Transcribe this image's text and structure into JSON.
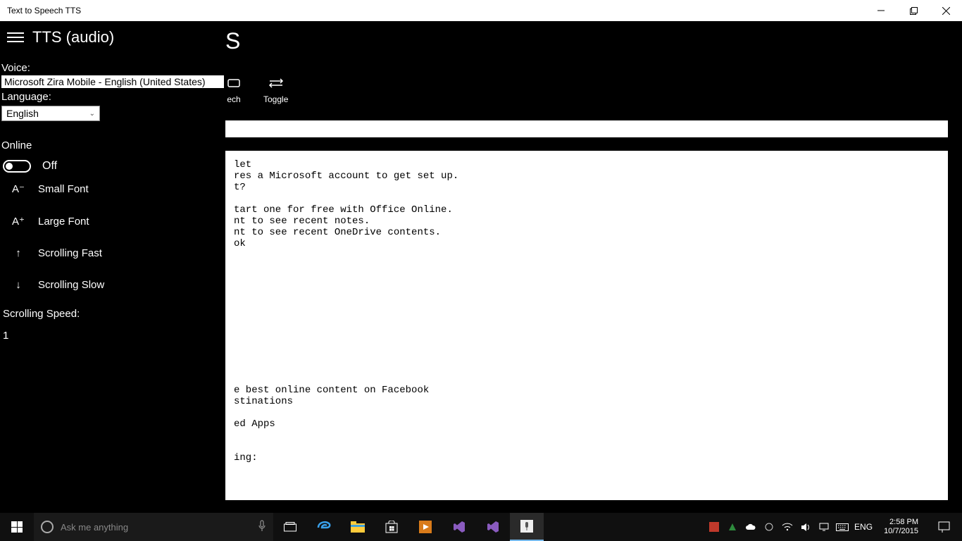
{
  "window": {
    "title": "Text to Speech TTS"
  },
  "main": {
    "title_suffix": "S",
    "toolbar": {
      "speech_label": "ech",
      "toggle_label": "Toggle"
    },
    "content_lines": [
      "let",
      "res a Microsoft account to get set up.",
      "t?",
      "",
      "tart one for free with Office Online.",
      "nt to see recent notes.",
      "nt to see recent OneDrive contents.",
      "ok",
      "",
      "",
      "",
      "",
      "",
      "",
      "",
      "",
      "",
      "",
      "",
      "",
      "e best online content on Facebook",
      "stinations",
      "",
      "ed Apps",
      "",
      "",
      "ing:"
    ]
  },
  "sidebar": {
    "title": "TTS (audio)",
    "voice_label": "Voice:",
    "voice_value": "Microsoft Zira Mobile - English (United States)",
    "language_label": "Language:",
    "language_value": "English",
    "online_label": "Online",
    "online_state": "Off",
    "items": [
      {
        "icon": "A⁻",
        "label": "Small Font"
      },
      {
        "icon": "A⁺",
        "label": "Large Font"
      },
      {
        "icon": "↑",
        "label": "Scrolling Fast"
      },
      {
        "icon": "↓",
        "label": "Scrolling Slow"
      }
    ],
    "scroll_speed_label": "Scrolling Speed:",
    "scroll_speed_value": "1"
  },
  "taskbar": {
    "search_placeholder": "Ask me anything",
    "lang": "ENG",
    "time": "2:58 PM",
    "date": "10/7/2015"
  }
}
